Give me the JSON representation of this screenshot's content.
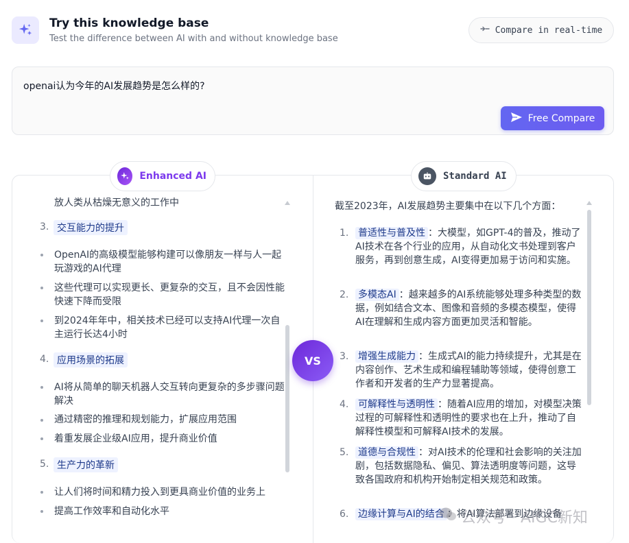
{
  "header": {
    "title": "Try this knowledge base",
    "subtitle": "Test the difference between AI with and without knowledge base",
    "compare_label": "Compare in real-time",
    "accent_color": "#6366f1"
  },
  "query": {
    "text": "openai认为今年的AI发展趋势是怎么样的?",
    "button_label": "Free Compare"
  },
  "enhanced": {
    "label": "Enhanced AI",
    "top_line": "放人类从枯燥无意义的工作中",
    "sections": [
      {
        "num": "3.",
        "title": "交互能力的提升",
        "bullets": [
          "OpenAI的高级模型能够构建可以像朋友一样与人一起玩游戏的AI代理",
          "这些代理可以实现更长、更复杂的交互，且不会因性能快速下降而受限",
          "到2024年年中，相关技术已经可以支持AI代理一次自主运行长达4小时"
        ]
      },
      {
        "num": "4.",
        "title": "应用场景的拓展",
        "bullets": [
          "AI将从简单的聊天机器人交互转向更复杂的多步骤问题解决",
          "通过精密的推理和规划能力，扩展应用范围",
          "着重发展企业级AI应用，提升商业价值"
        ]
      },
      {
        "num": "5.",
        "title": "生产力的革新",
        "bullets": [
          "让人们将时间和精力投入到更具商业价值的业务上",
          "提高工作效率和自动化水平"
        ]
      }
    ]
  },
  "vs_label": "VS",
  "standard": {
    "label": "Standard AI",
    "intro": "截至2023年，AI发展趋势主要集中在以下几个方面：",
    "items": [
      {
        "num": "1.",
        "title": "普适性与普及性",
        "text": "：大模型，如GPT-4的普及，推动了AI技术在各个行业的应用，从自动化文书处理到客户服务，再到创意生成，AI变得更加易于访问和实施。"
      },
      {
        "num": "2.",
        "title": "多模态AI",
        "text": "：越来越多的AI系统能够处理多种类型的数据，例如结合文本、图像和音频的多模态模型，使得AI在理解和生成内容方面更加灵活和智能。"
      },
      {
        "num": "3.",
        "title": "增强生成能力",
        "text": "：生成式AI的能力持续提升，尤其是在内容创作、艺术生成和编程辅助等领域，使得创意工作者和开发者的生产力显著提高。"
      },
      {
        "num": "4.",
        "title": "可解释性与透明性",
        "text": "：随着AI应用的增加，对模型决策过程的可解释性和透明性的要求也在上升，推动了自解释性模型和可解释AI技术的发展。"
      },
      {
        "num": "5.",
        "title": "道德与合规性",
        "text": "：对AI技术的伦理和社会影响的关注加剧，包括数据隐私、偏见、算法透明度等问题，这导致各国政府和机构开始制定相关规范和政策。"
      },
      {
        "num": "6.",
        "title": "边缘计算与AI的结合",
        "text": "：将AI算法部署到边缘设备"
      }
    ]
  },
  "watermark": "公众号 · AIGC新知"
}
